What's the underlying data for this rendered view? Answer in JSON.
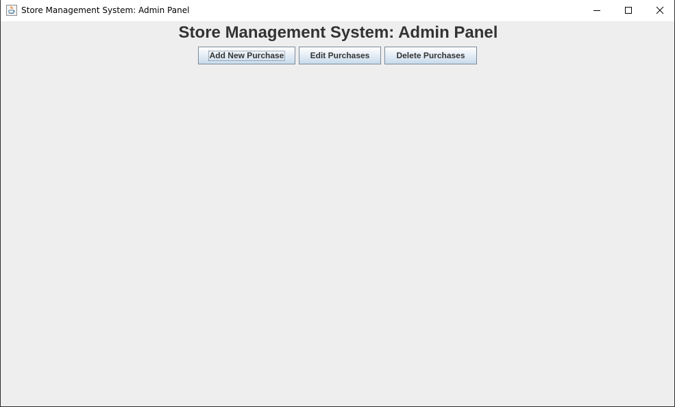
{
  "window": {
    "title": "Store Management System: Admin Panel",
    "icon": "java-app-icon",
    "controls": {
      "minimize_icon": "minimize-icon",
      "maximize_icon": "maximize-icon",
      "close_icon": "close-icon"
    }
  },
  "main": {
    "title": "Store Management System: Admin Panel",
    "buttons": {
      "add_label": "Add New Purchase",
      "edit_label": "Edit Purchases",
      "delete_label": "Delete Purchases"
    },
    "focused_button": "Add New Purchase"
  },
  "colors": {
    "content_background": "#eeeeee",
    "title_text": "#333333",
    "button_border": "#7a8a99",
    "button_gradient_bottom": "#c9dbec"
  }
}
